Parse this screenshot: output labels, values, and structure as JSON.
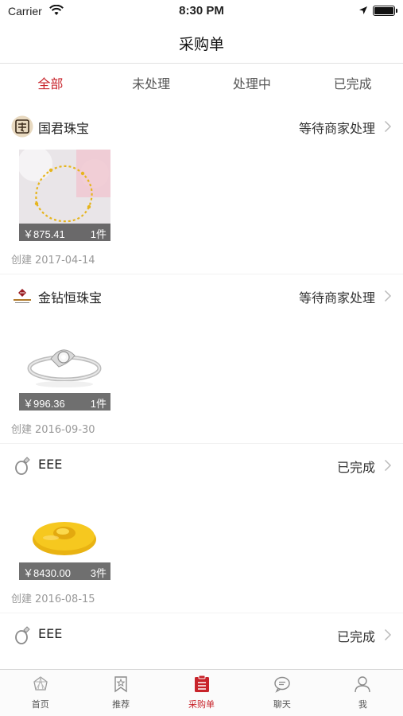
{
  "status_bar": {
    "carrier": "Carrier",
    "time": "8:30 PM"
  },
  "nav": {
    "title": "采购单"
  },
  "tabs": [
    {
      "label": "全部",
      "active": true
    },
    {
      "label": "未处理",
      "active": false
    },
    {
      "label": "处理中",
      "active": false
    },
    {
      "label": "已完成",
      "active": false
    }
  ],
  "created_label": "创建",
  "orders": [
    {
      "shop": "国君珠宝",
      "status": "等待商家处理",
      "price": "￥875.41",
      "qty": "1件",
      "created": "2017-04-14",
      "product": "gold-bracelet"
    },
    {
      "shop": "金钻恒珠宝",
      "status": "等待商家处理",
      "price": "￥996.36",
      "qty": "1件",
      "created": "2016-09-30",
      "product": "silver-diamond-ring"
    },
    {
      "shop": "EEE",
      "status": "已完成",
      "price": "￥8430.00",
      "qty": "3件",
      "created": "2016-08-15",
      "product": "gold-ingot"
    },
    {
      "shop": "EEE",
      "status": "已完成"
    }
  ],
  "tabbar": [
    {
      "label": "首页",
      "icon": "home-icon",
      "active": false
    },
    {
      "label": "推荐",
      "icon": "star-bookmark-icon",
      "active": false
    },
    {
      "label": "采购单",
      "icon": "purchase-list-icon",
      "active": true
    },
    {
      "label": "聊天",
      "icon": "chat-icon",
      "active": false
    },
    {
      "label": "我",
      "icon": "user-icon",
      "active": false
    }
  ],
  "colors": {
    "accent": "#c8242b",
    "gold": "#f2c21b",
    "text_muted": "#999999"
  }
}
